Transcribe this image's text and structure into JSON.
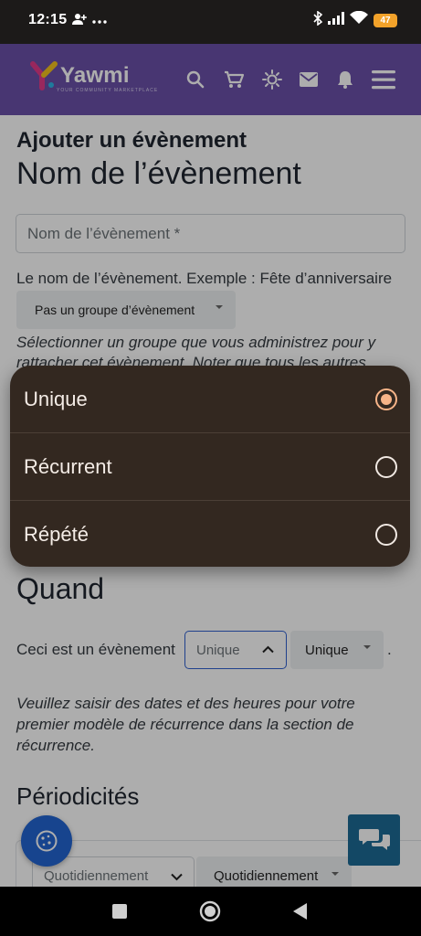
{
  "status_bar": {
    "time": "12:15",
    "battery": "47",
    "icons": [
      "person-add-icon",
      "more-dots-icon",
      "bluetooth-icon",
      "signal-icon",
      "wifi-icon",
      "battery-icon"
    ]
  },
  "header": {
    "logo_text": "Yawmi",
    "logo_tagline": "YOUR COMMUNITY MARKETPLACE",
    "icons": [
      "search-icon",
      "cart-icon",
      "brightness-icon",
      "mail-icon",
      "bell-icon",
      "menu-icon"
    ],
    "color": "#6a50a8"
  },
  "form": {
    "page_heading": "Ajouter un évènement",
    "name_section_title": "Nom de l’évènement",
    "name_placeholder": "Nom de l’évènement *",
    "name_help": "Le nom de l’évènement. Exemple : Fête d’anniversaire",
    "group_select_value": "Pas un groupe d’évènement",
    "group_help": "Sélectionner un groupe que vous administrez pour y rattacher cet évènement. Noter que tous les autres",
    "when_title": "Quand",
    "event_type_label": "Ceci est un évènement",
    "event_type_value": "Unique",
    "event_type_native_value": "Unique",
    "trailing_period": ".",
    "recurrence_help": "Veuillez saisir des dates et des heures pour votre premier modèle de récurrence dans la section de récurrence.",
    "periodicities_title": "Périodicités",
    "periodicity_value_1": "Quotidiennement",
    "periodicity_value_2": "Quotidiennement"
  },
  "popup": {
    "options": [
      {
        "label": "Unique",
        "selected": true
      },
      {
        "label": "Récurrent",
        "selected": false
      },
      {
        "label": "Répété",
        "selected": false
      }
    ],
    "accent": "#f7b488",
    "background": "#332820"
  },
  "floating": {
    "cookie_button_icon": "cookie-icon",
    "chat_button_icon": "chat-bubbles-icon"
  },
  "nav_bar": {
    "icons": [
      "recents-square-icon",
      "home-circle-icon",
      "back-triangle-icon"
    ]
  }
}
